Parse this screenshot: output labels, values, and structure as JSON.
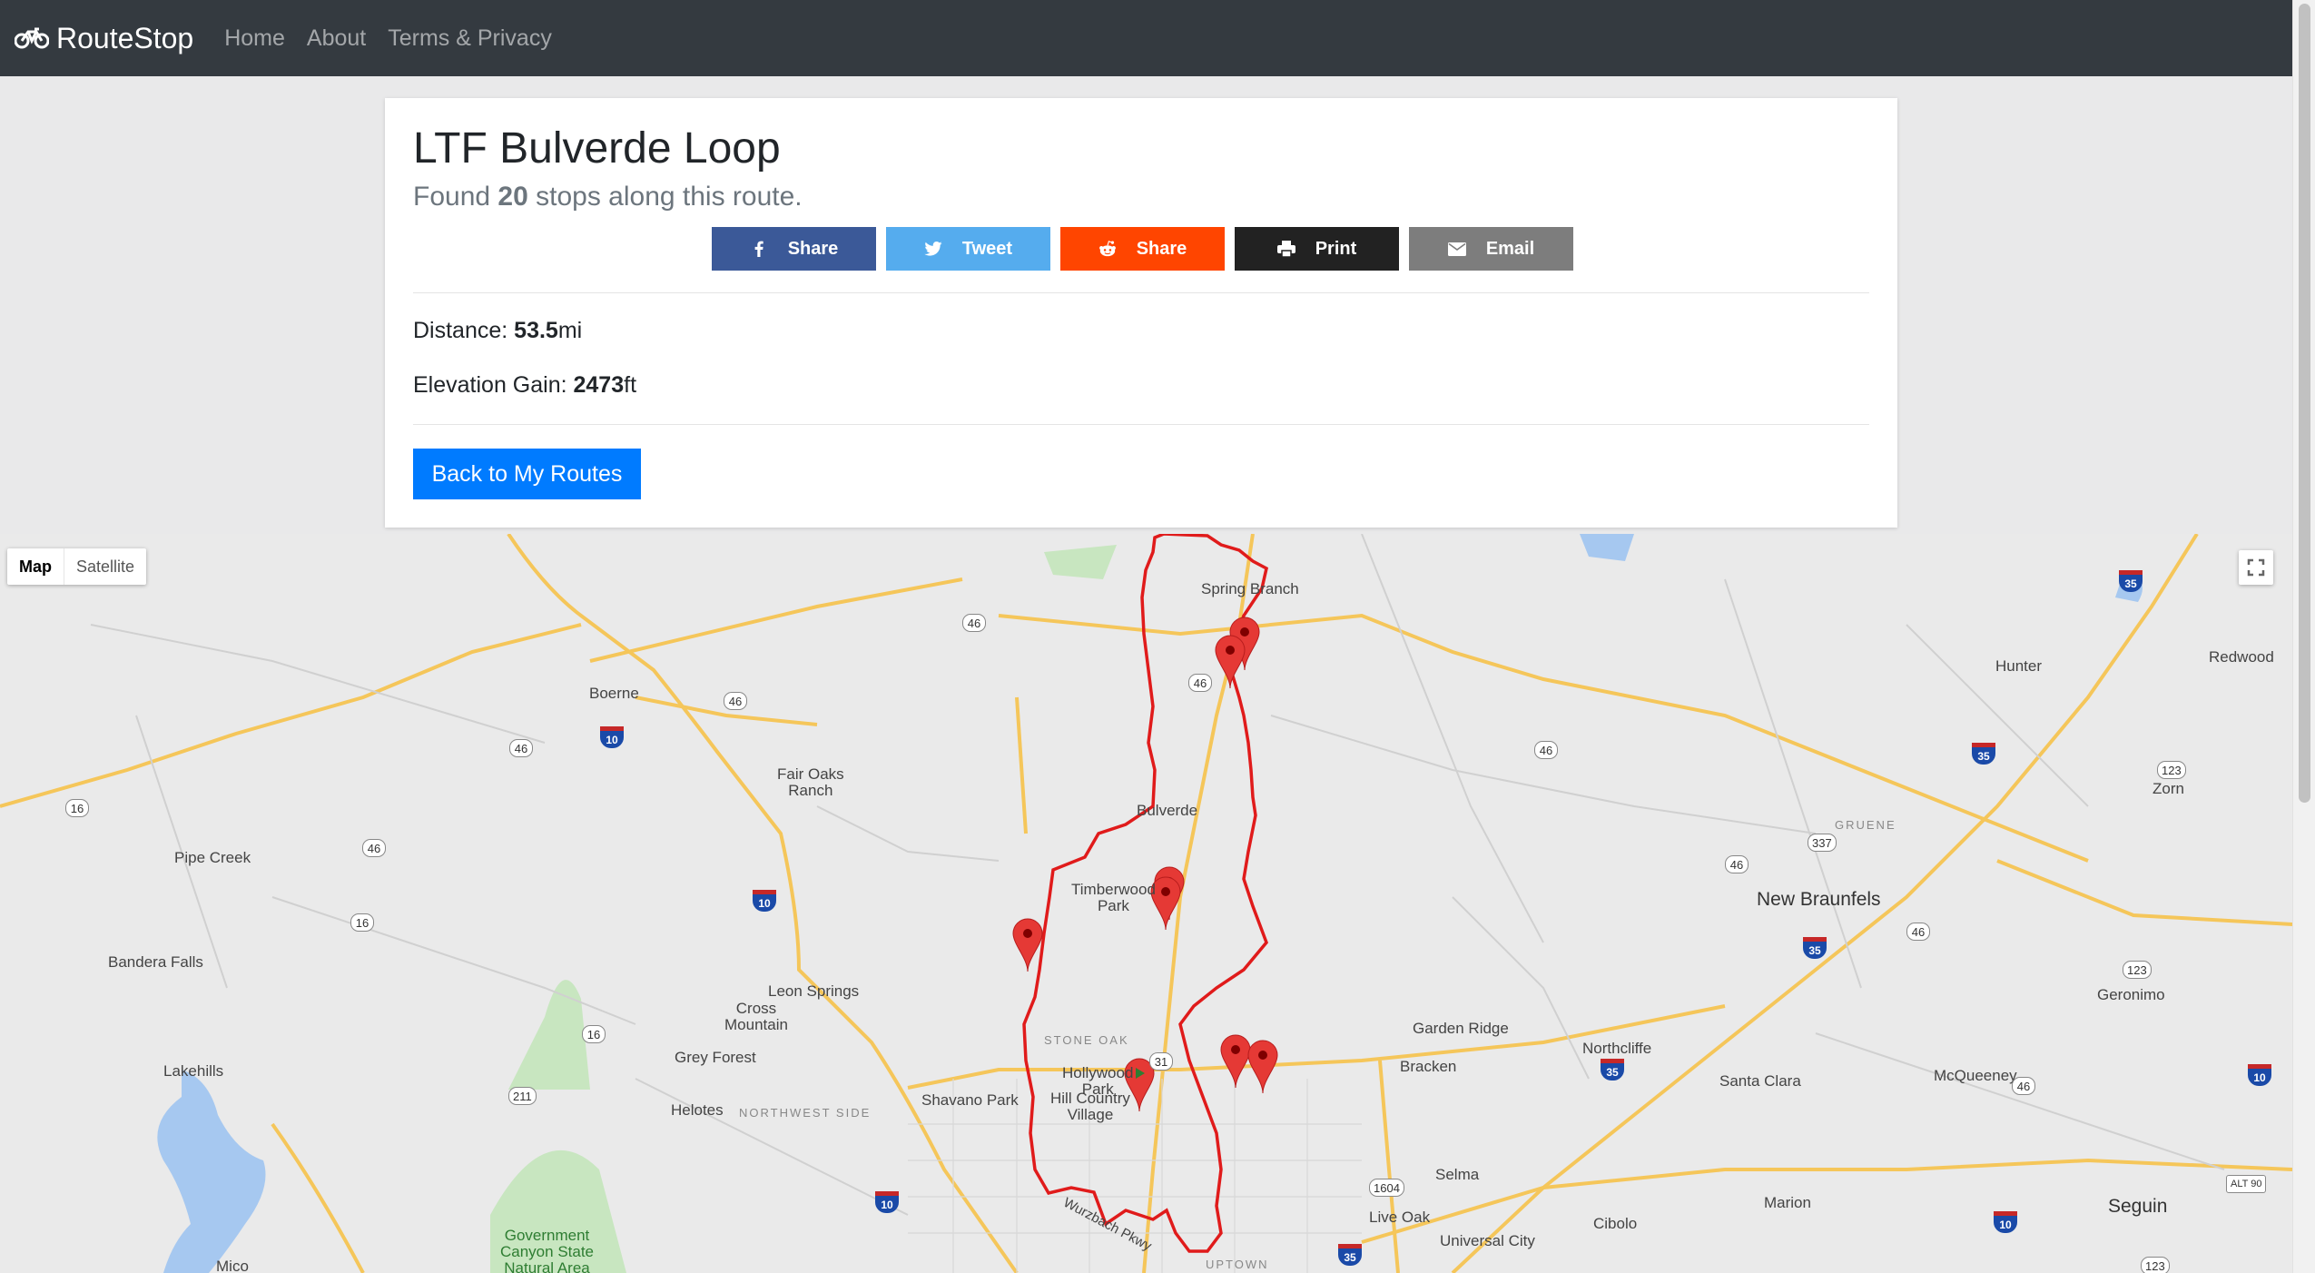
{
  "navbar": {
    "brand": "RouteStop",
    "links": [
      "Home",
      "About",
      "Terms & Privacy"
    ]
  },
  "route": {
    "title": "LTF Bulverde Loop",
    "found_prefix": "Found ",
    "stop_count": "20",
    "found_suffix": " stops along this route.",
    "distance_label": "Distance: ",
    "distance_value": "53.5",
    "distance_unit": "mi",
    "elevation_label": "Elevation Gain: ",
    "elevation_value": "2473",
    "elevation_unit": "ft",
    "back_button": "Back to My Routes"
  },
  "share": {
    "facebook": "Share",
    "twitter": "Tweet",
    "reddit": "Share",
    "print": "Print",
    "email": "Email"
  },
  "map": {
    "type_map": "Map",
    "type_satellite": "Satellite",
    "places": {
      "spring_branch": "Spring Branch",
      "boerne": "Boerne",
      "fair_oaks": "Fair Oaks\nRanch",
      "bulverde": "Bulverde",
      "timberwood": "Timberwood\nPark",
      "pipe_creek": "Pipe Creek",
      "bandera_falls": "Bandera Falls",
      "leon_springs": "Leon Springs",
      "cross_mountain": "Cross\nMountain",
      "stone_oak": "STONE OAK",
      "garden_ridge": "Garden Ridge",
      "bracken": "Bracken",
      "northcliffe": "Northcliffe",
      "grey_forest": "Grey Forest",
      "lakehills": "Lakehills",
      "hollywood_park": "Hollywood\nPark",
      "shavano_park": "Shavano Park",
      "hill_country_village": "Hill Country\nVillage",
      "helotes": "Helotes",
      "northwest_side": "NORTHWEST SIDE",
      "selma": "Selma",
      "live_oak": "Live Oak",
      "cibolo": "Cibolo",
      "universal_city": "Universal City",
      "hunter": "Hunter",
      "redwood": "Redwood",
      "zorn": "Zorn",
      "gruene": "GRUENE",
      "new_braunfels": "New Braunfels",
      "geronimo": "Geronimo",
      "santa_clara": "Santa Clara",
      "mcqueeney": "McQueeney",
      "marion": "Marion",
      "seguin": "Seguin",
      "government_canyon": "Government\nCanyon State\nNatural Area",
      "mico": "Mico",
      "uptown": "UPTOWN",
      "wurzbach": "Wurzbach Pkwy"
    },
    "shields": {
      "s46a": "46",
      "s46b": "46",
      "s46c": "46",
      "s46d": "46",
      "s46e": "46",
      "s46f": "46",
      "s46g": "46",
      "s46h": "46",
      "s46i": "46",
      "s16a": "16",
      "s16b": "16",
      "s16c": "16",
      "s211": "211",
      "s337": "337",
      "s123a": "123",
      "s123b": "123",
      "s123c": "123",
      "s1604": "1604",
      "s31": "31",
      "i10a": "10",
      "i10b": "10",
      "i10c": "10",
      "i10d": "10",
      "i10e": "10",
      "i35a": "35",
      "i35b": "35",
      "i35c": "35",
      "i35d": "35",
      "i35e": "35",
      "alt90": "ALT 90"
    }
  }
}
